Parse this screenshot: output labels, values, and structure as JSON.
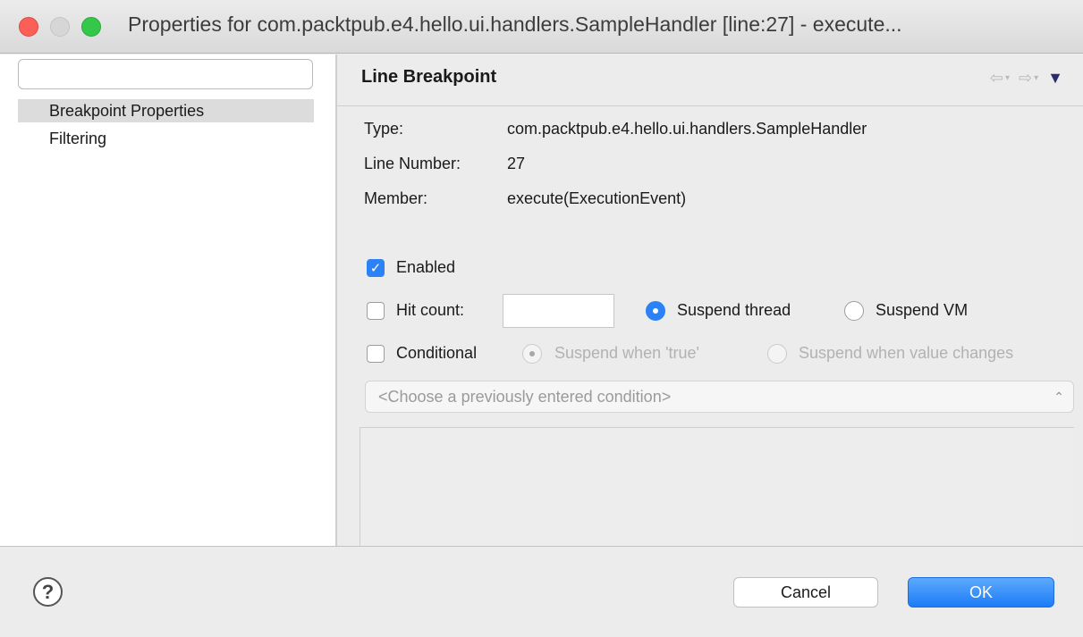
{
  "window": {
    "title": "Properties for com.packtpub.e4.hello.ui.handlers.SampleHandler [line:27] - execute..."
  },
  "sidebar": {
    "filter_value": "",
    "items": [
      {
        "label": "Breakpoint Properties",
        "selected": true
      },
      {
        "label": "Filtering",
        "selected": false
      }
    ]
  },
  "header": {
    "title": "Line Breakpoint",
    "back_icon": "back-arrow-icon",
    "forward_icon": "forward-arrow-icon",
    "menu_icon": "view-menu-icon"
  },
  "info": {
    "type_label": "Type:",
    "type_value": "com.packtpub.e4.hello.ui.handlers.SampleHandler",
    "line_label": "Line Number:",
    "line_value": "27",
    "member_label": "Member:",
    "member_value": "execute(ExecutionEvent)"
  },
  "options": {
    "enabled_label": "Enabled",
    "enabled_checked": true,
    "hit_count_label": "Hit count:",
    "hit_count_checked": false,
    "hit_count_value": "",
    "suspend_thread_label": "Suspend thread",
    "suspend_vm_label": "Suspend VM",
    "suspend_policy": "Suspend thread",
    "conditional_label": "Conditional",
    "conditional_checked": false,
    "suspend_true_label": "Suspend when 'true'",
    "suspend_changes_label": "Suspend when value changes",
    "condition_select_value": "<Choose a previously entered condition>"
  },
  "footer": {
    "cancel_label": "Cancel",
    "ok_label": "OK",
    "help_icon": "help-icon"
  },
  "colors": {
    "accent": "#2b82f6",
    "selection": "#dcdcdc"
  }
}
